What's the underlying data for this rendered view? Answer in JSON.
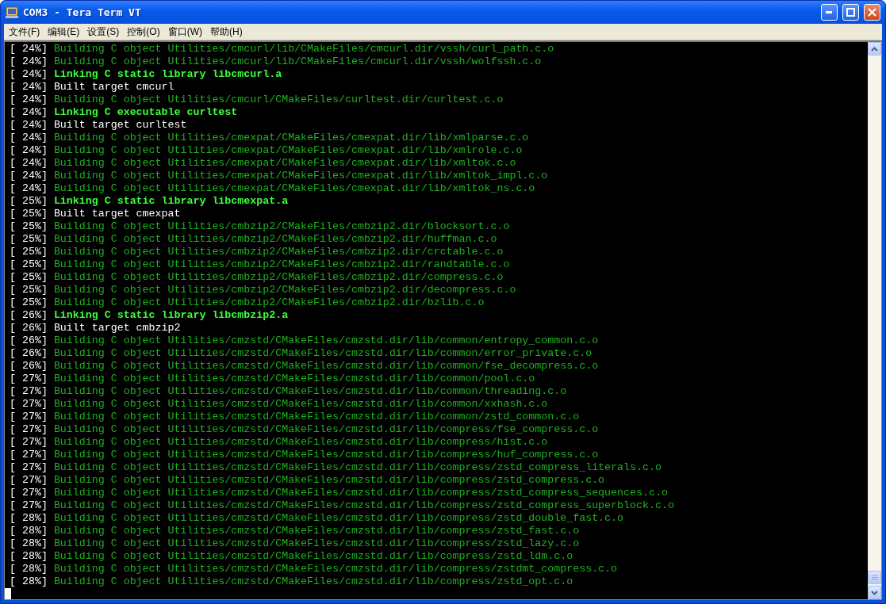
{
  "window": {
    "title": "COM3 - Tera Term VT"
  },
  "menu": [
    "文件(F)",
    "编辑(E)",
    "设置(S)",
    "控制(O)",
    "窗口(W)",
    "帮助(H)"
  ],
  "terminal": {
    "lines": [
      {
        "progress": "[ 24%]",
        "kind": "build",
        "text": "Building C object Utilities/cmcurl/lib/CMakeFiles/cmcurl.dir/vssh/curl_path.c.o"
      },
      {
        "progress": "[ 24%]",
        "kind": "build",
        "text": "Building C object Utilities/cmcurl/lib/CMakeFiles/cmcurl.dir/vssh/wolfssh.c.o"
      },
      {
        "progress": "[ 24%]",
        "kind": "link",
        "text": "Linking C static library libcmcurl.a"
      },
      {
        "progress": "[ 24%]",
        "kind": "built",
        "text": "Built target cmcurl"
      },
      {
        "progress": "[ 24%]",
        "kind": "build",
        "text": "Building C object Utilities/cmcurl/CMakeFiles/curltest.dir/curltest.c.o"
      },
      {
        "progress": "[ 24%]",
        "kind": "link",
        "text": "Linking C executable curltest"
      },
      {
        "progress": "[ 24%]",
        "kind": "built",
        "text": "Built target curltest"
      },
      {
        "progress": "[ 24%]",
        "kind": "build",
        "text": "Building C object Utilities/cmexpat/CMakeFiles/cmexpat.dir/lib/xmlparse.c.o"
      },
      {
        "progress": "[ 24%]",
        "kind": "build",
        "text": "Building C object Utilities/cmexpat/CMakeFiles/cmexpat.dir/lib/xmlrole.c.o"
      },
      {
        "progress": "[ 24%]",
        "kind": "build",
        "text": "Building C object Utilities/cmexpat/CMakeFiles/cmexpat.dir/lib/xmltok.c.o"
      },
      {
        "progress": "[ 24%]",
        "kind": "build",
        "text": "Building C object Utilities/cmexpat/CMakeFiles/cmexpat.dir/lib/xmltok_impl.c.o"
      },
      {
        "progress": "[ 24%]",
        "kind": "build",
        "text": "Building C object Utilities/cmexpat/CMakeFiles/cmexpat.dir/lib/xmltok_ns.c.o"
      },
      {
        "progress": "[ 25%]",
        "kind": "link",
        "text": "Linking C static library libcmexpat.a"
      },
      {
        "progress": "[ 25%]",
        "kind": "built",
        "text": "Built target cmexpat"
      },
      {
        "progress": "[ 25%]",
        "kind": "build",
        "text": "Building C object Utilities/cmbzip2/CMakeFiles/cmbzip2.dir/blocksort.c.o"
      },
      {
        "progress": "[ 25%]",
        "kind": "build",
        "text": "Building C object Utilities/cmbzip2/CMakeFiles/cmbzip2.dir/huffman.c.o"
      },
      {
        "progress": "[ 25%]",
        "kind": "build",
        "text": "Building C object Utilities/cmbzip2/CMakeFiles/cmbzip2.dir/crctable.c.o"
      },
      {
        "progress": "[ 25%]",
        "kind": "build",
        "text": "Building C object Utilities/cmbzip2/CMakeFiles/cmbzip2.dir/randtable.c.o"
      },
      {
        "progress": "[ 25%]",
        "kind": "build",
        "text": "Building C object Utilities/cmbzip2/CMakeFiles/cmbzip2.dir/compress.c.o"
      },
      {
        "progress": "[ 25%]",
        "kind": "build",
        "text": "Building C object Utilities/cmbzip2/CMakeFiles/cmbzip2.dir/decompress.c.o"
      },
      {
        "progress": "[ 25%]",
        "kind": "build",
        "text": "Building C object Utilities/cmbzip2/CMakeFiles/cmbzip2.dir/bzlib.c.o"
      },
      {
        "progress": "[ 26%]",
        "kind": "link",
        "text": "Linking C static library libcmbzip2.a"
      },
      {
        "progress": "[ 26%]",
        "kind": "built",
        "text": "Built target cmbzip2"
      },
      {
        "progress": "[ 26%]",
        "kind": "build",
        "text": "Building C object Utilities/cmzstd/CMakeFiles/cmzstd.dir/lib/common/entropy_common.c.o"
      },
      {
        "progress": "[ 26%]",
        "kind": "build",
        "text": "Building C object Utilities/cmzstd/CMakeFiles/cmzstd.dir/lib/common/error_private.c.o"
      },
      {
        "progress": "[ 26%]",
        "kind": "build",
        "text": "Building C object Utilities/cmzstd/CMakeFiles/cmzstd.dir/lib/common/fse_decompress.c.o"
      },
      {
        "progress": "[ 27%]",
        "kind": "build",
        "text": "Building C object Utilities/cmzstd/CMakeFiles/cmzstd.dir/lib/common/pool.c.o"
      },
      {
        "progress": "[ 27%]",
        "kind": "build",
        "text": "Building C object Utilities/cmzstd/CMakeFiles/cmzstd.dir/lib/common/threading.c.o"
      },
      {
        "progress": "[ 27%]",
        "kind": "build",
        "text": "Building C object Utilities/cmzstd/CMakeFiles/cmzstd.dir/lib/common/xxhash.c.o"
      },
      {
        "progress": "[ 27%]",
        "kind": "build",
        "text": "Building C object Utilities/cmzstd/CMakeFiles/cmzstd.dir/lib/common/zstd_common.c.o"
      },
      {
        "progress": "[ 27%]",
        "kind": "build",
        "text": "Building C object Utilities/cmzstd/CMakeFiles/cmzstd.dir/lib/compress/fse_compress.c.o"
      },
      {
        "progress": "[ 27%]",
        "kind": "build",
        "text": "Building C object Utilities/cmzstd/CMakeFiles/cmzstd.dir/lib/compress/hist.c.o"
      },
      {
        "progress": "[ 27%]",
        "kind": "build",
        "text": "Building C object Utilities/cmzstd/CMakeFiles/cmzstd.dir/lib/compress/huf_compress.c.o"
      },
      {
        "progress": "[ 27%]",
        "kind": "build",
        "text": "Building C object Utilities/cmzstd/CMakeFiles/cmzstd.dir/lib/compress/zstd_compress_literals.c.o"
      },
      {
        "progress": "[ 27%]",
        "kind": "build",
        "text": "Building C object Utilities/cmzstd/CMakeFiles/cmzstd.dir/lib/compress/zstd_compress.c.o"
      },
      {
        "progress": "[ 27%]",
        "kind": "build",
        "text": "Building C object Utilities/cmzstd/CMakeFiles/cmzstd.dir/lib/compress/zstd_compress_sequences.c.o"
      },
      {
        "progress": "[ 27%]",
        "kind": "build",
        "text": "Building C object Utilities/cmzstd/CMakeFiles/cmzstd.dir/lib/compress/zstd_compress_superblock.c.o"
      },
      {
        "progress": "[ 28%]",
        "kind": "build",
        "text": "Building C object Utilities/cmzstd/CMakeFiles/cmzstd.dir/lib/compress/zstd_double_fast.c.o"
      },
      {
        "progress": "[ 28%]",
        "kind": "build",
        "text": "Building C object Utilities/cmzstd/CMakeFiles/cmzstd.dir/lib/compress/zstd_fast.c.o"
      },
      {
        "progress": "[ 28%]",
        "kind": "build",
        "text": "Building C object Utilities/cmzstd/CMakeFiles/cmzstd.dir/lib/compress/zstd_lazy.c.o"
      },
      {
        "progress": "[ 28%]",
        "kind": "build",
        "text": "Building C object Utilities/cmzstd/CMakeFiles/cmzstd.dir/lib/compress/zstd_ldm.c.o"
      },
      {
        "progress": "[ 28%]",
        "kind": "build",
        "text": "Building C object Utilities/cmzstd/CMakeFiles/cmzstd.dir/lib/compress/zstdmt_compress.c.o"
      },
      {
        "progress": "[ 28%]",
        "kind": "build",
        "text": "Building C object Utilities/cmzstd/CMakeFiles/cmzstd.dir/lib/compress/zstd_opt.c.o"
      }
    ]
  }
}
